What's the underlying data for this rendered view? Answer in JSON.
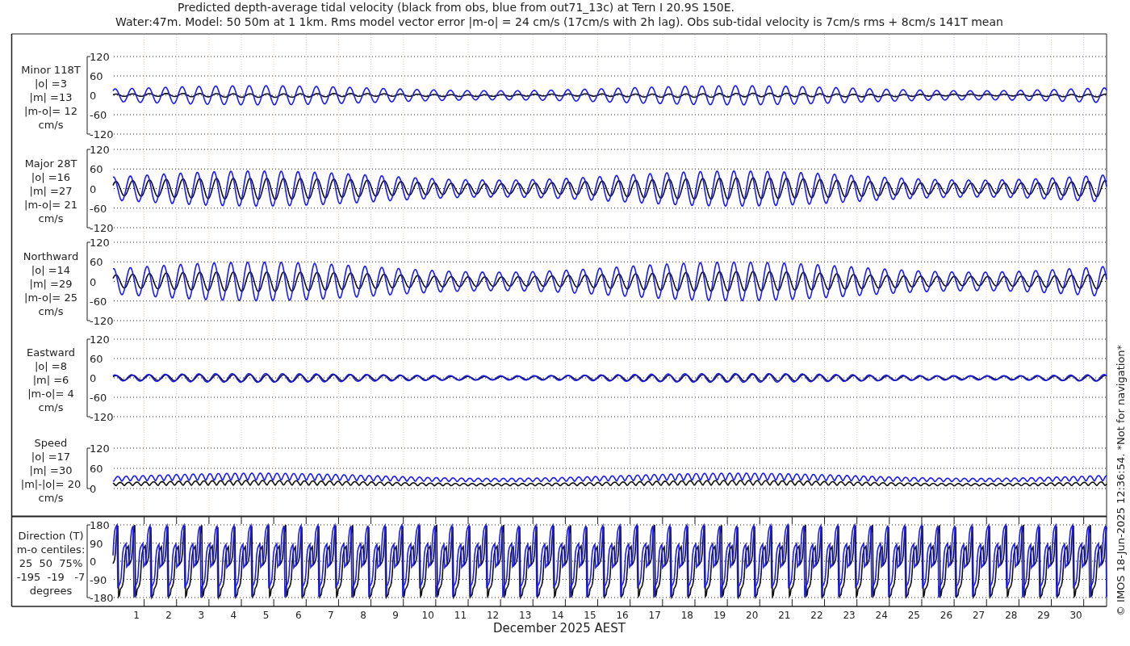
{
  "title": {
    "line_1": "Predicted depth-average tidal velocity (black from obs, blue from out71_13c) at Tern I 20.9S 150E.",
    "line_2": "Water:47m. Model: 50 50m at 1 1km. Rms model vector error |m-o| = 24 cm/s (17cm/s with 2h lag). Obs sub-tidal velocity is 7cm/s rms + 8cm/s 141T mean"
  },
  "panels": [
    {
      "kind": "minor",
      "label": [
        "Minor 118T",
        "|o| =3",
        "|m| =13",
        "|m-o|= 12",
        "cm/s"
      ],
      "yticks": [
        "120",
        "60",
        "0",
        "-60",
        "-120"
      ]
    },
    {
      "kind": "major",
      "label": [
        "Major 28T",
        "|o| =16",
        "|m| =27",
        "|m-o|= 21",
        "cm/s"
      ],
      "yticks": [
        "120",
        "60",
        "0",
        "-60",
        "-120"
      ]
    },
    {
      "kind": "north",
      "label": [
        "Northward",
        "|o| =14",
        "|m| =29",
        "|m-o|= 25",
        "cm/s"
      ],
      "yticks": [
        "120",
        "60",
        "0",
        "-60",
        "-120"
      ]
    },
    {
      "kind": "east",
      "label": [
        "Eastward",
        "|o| =8",
        "|m| =6",
        "|m-o|= 4",
        "cm/s"
      ],
      "yticks": [
        "120",
        "60",
        "0",
        "-60",
        "-120"
      ]
    },
    {
      "kind": "speed",
      "label": [
        "Speed",
        "|o| =17",
        "|m| =30",
        "|m|-|o|= 20",
        "cm/s"
      ],
      "yticks": [
        "120",
        "60",
        "0"
      ]
    },
    {
      "kind": "direction",
      "label": [
        "Direction (T)",
        "m-o centiles:",
        "25  50  75%",
        "-195  -19   -7",
        "degrees"
      ],
      "yticks": [
        "180",
        "90",
        "0",
        "-90",
        "-180"
      ]
    }
  ],
  "x_axis": {
    "ticks": [
      "1",
      "2",
      "3",
      "4",
      "5",
      "6",
      "7",
      "8",
      "9",
      "10",
      "11",
      "12",
      "13",
      "14",
      "15",
      "16",
      "17",
      "18",
      "19",
      "20",
      "21",
      "22",
      "23",
      "24",
      "25",
      "26",
      "27",
      "28",
      "29",
      "30"
    ],
    "label": "December 2025 AEST"
  },
  "footer": "© IMOS 18-Jun-2025 12:36:54. *Not for navigation*"
}
